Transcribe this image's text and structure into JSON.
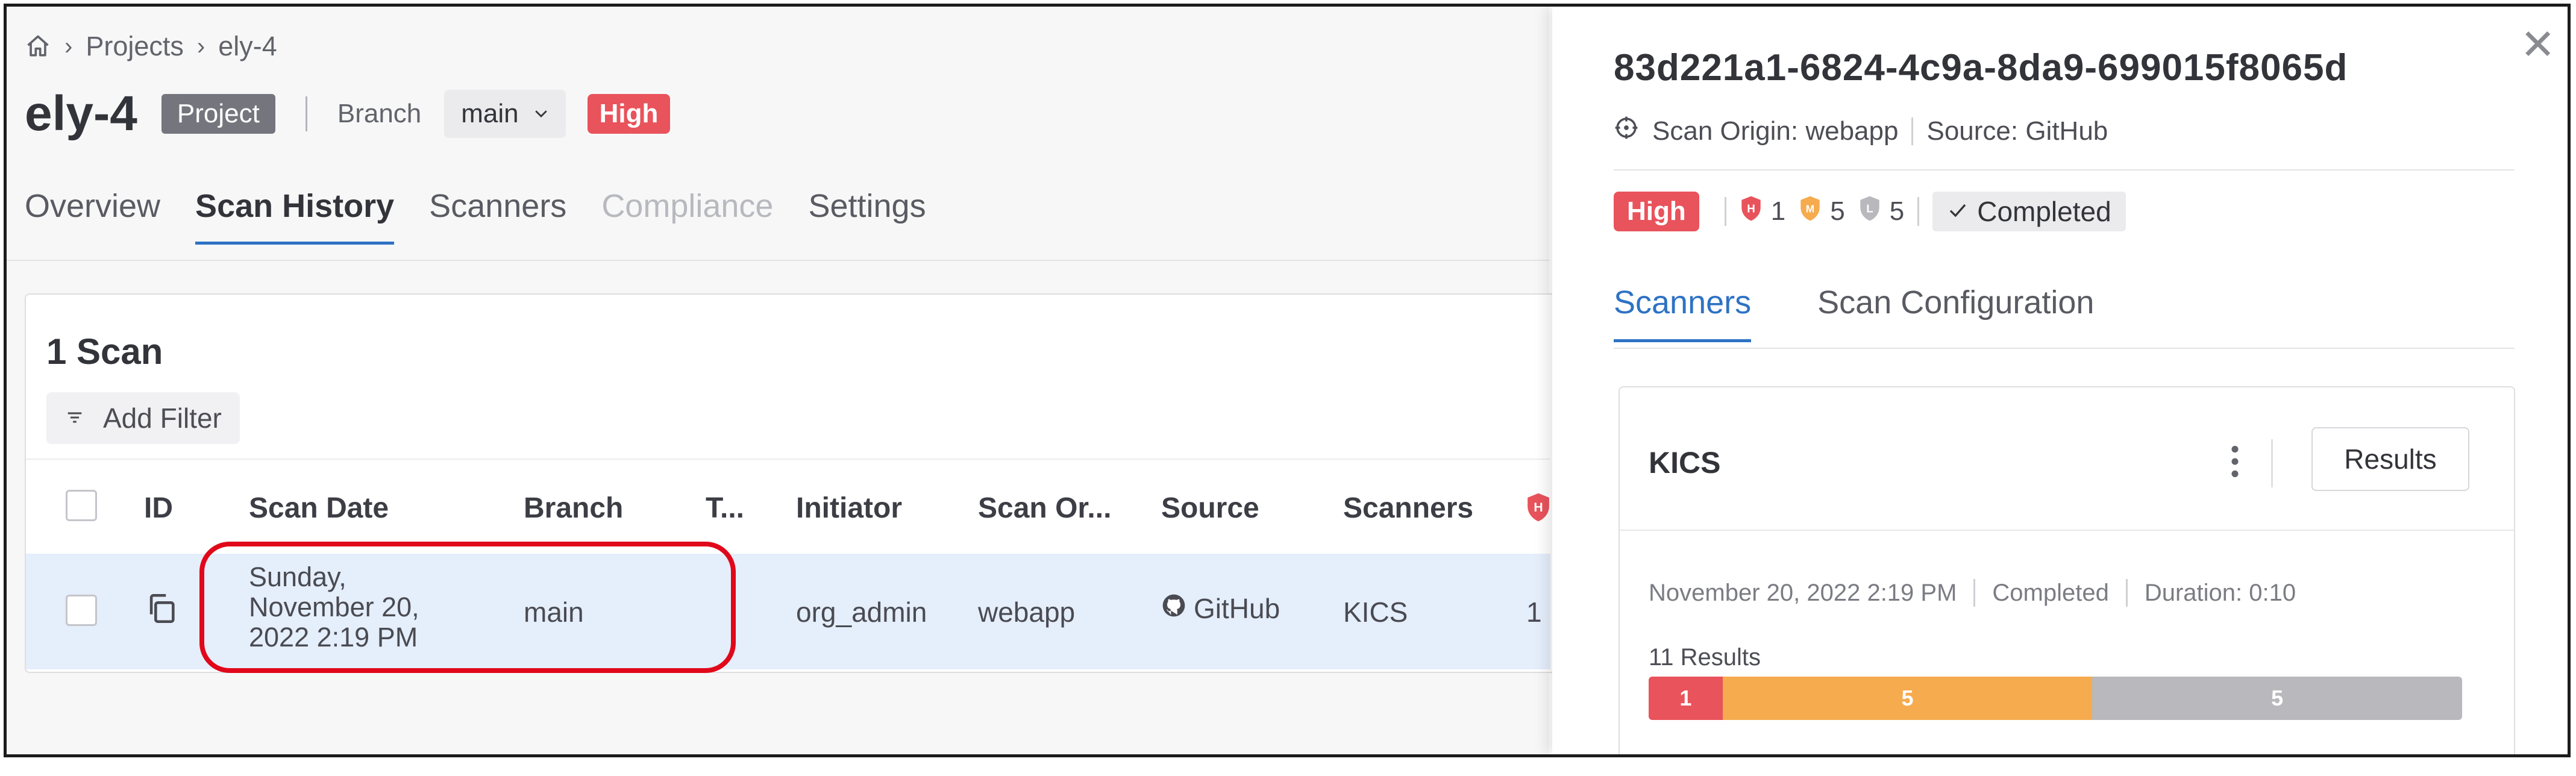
{
  "breadcrumb": {
    "items": [
      "Projects",
      "ely-4"
    ]
  },
  "project": {
    "name": "ely-4",
    "type_badge": "Project",
    "branch_label": "Branch",
    "branch_value": "main",
    "risk_badge": "High"
  },
  "tabs": [
    {
      "label": "Overview",
      "state": "normal"
    },
    {
      "label": "Scan History",
      "state": "active"
    },
    {
      "label": "Scanners",
      "state": "normal"
    },
    {
      "label": "Compliance",
      "state": "disabled"
    },
    {
      "label": "Settings",
      "state": "normal"
    }
  ],
  "scans": {
    "count_label": "1 Scan",
    "add_filter_label": "Add Filter",
    "columns": [
      "ID",
      "Scan Date",
      "Branch",
      "T...",
      "Initiator",
      "Scan Or...",
      "Source",
      "Scanners"
    ],
    "row": {
      "date_line1": "Sunday,",
      "date_line2": "November 20,",
      "date_line3": "2022 2:19 PM",
      "branch": "main",
      "initiator": "org_admin",
      "scan_origin": "webapp",
      "source": "GitHub",
      "scanners": "KICS",
      "high_count": "1"
    }
  },
  "drawer": {
    "scan_id": "83d221a1-6824-4c9a-8da9-699015f8065d",
    "scan_origin": "Scan Origin: webapp",
    "source": "Source: GitHub",
    "risk_badge": "High",
    "high_count": "1",
    "medium_count": "5",
    "low_count": "5",
    "status": "Completed",
    "tabs": [
      {
        "label": "Scanners",
        "state": "active"
      },
      {
        "label": "Scan Configuration",
        "state": "normal"
      }
    ],
    "scanner_card": {
      "name": "KICS",
      "results_button": "Results",
      "date": "November 20, 2022 2:19 PM",
      "status": "Completed",
      "duration": "Duration: 0:10",
      "results_count": "11 Results",
      "breakdown": [
        {
          "severity": "high",
          "value": 1,
          "label": "1",
          "color": "#e9535b"
        },
        {
          "severity": "medium",
          "value": 5,
          "label": "5",
          "color": "#f5ab4e"
        },
        {
          "severity": "low",
          "value": 5,
          "label": "5",
          "color": "#b9b8bd"
        }
      ]
    }
  },
  "colors": {
    "accent": "#2e72c4",
    "high": "#e9535b",
    "medium": "#f5ab4e",
    "low": "#b9b8bd",
    "highlight": "#e0081a"
  },
  "icons": [
    "home-icon",
    "chevron-right-icon",
    "chevron-down-icon",
    "filter-icon",
    "copy-icon",
    "github-icon",
    "high-severity-icon",
    "medium-severity-icon",
    "low-severity-icon",
    "checkmark-icon",
    "crosshair-icon",
    "close-icon",
    "kebab-menu-icon"
  ]
}
